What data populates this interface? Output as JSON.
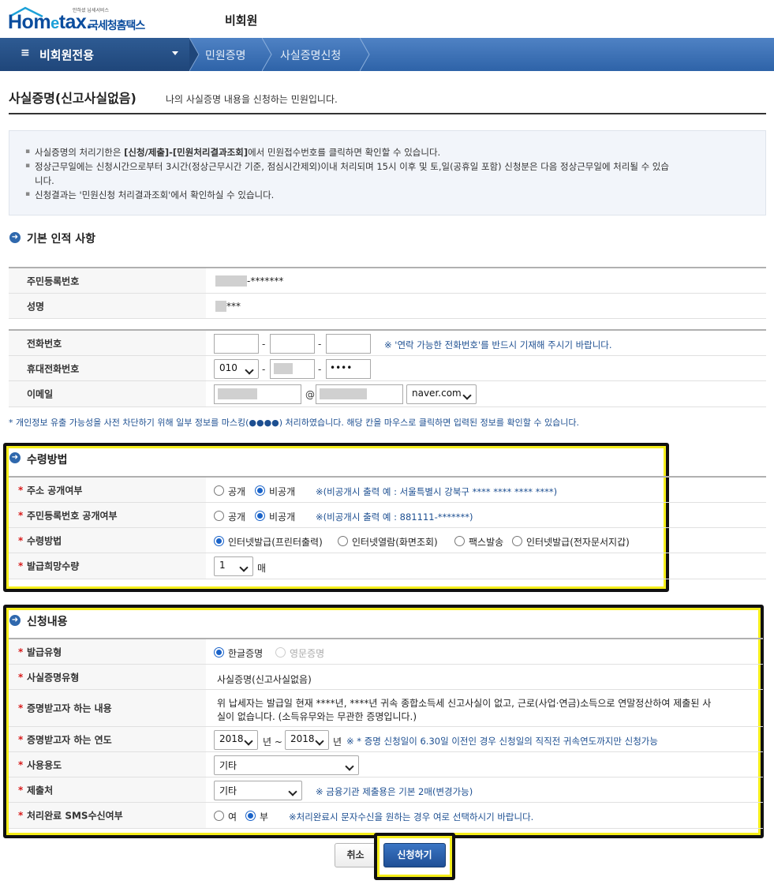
{
  "header": {
    "logo_tagline": "안하셨 납세서비스",
    "logo_home": "Hom",
    "logo_e": "e",
    "logo_tax": "tax.",
    "logo_kor": "국세청홈택스",
    "member_label": "비회원"
  },
  "nav": {
    "menu_label": "비회원전용",
    "items": [
      "민원증명",
      "사실증명신청"
    ]
  },
  "page": {
    "title": "사실증명(신고사실없음)",
    "subtitle": "나의 사실증명 내용을 신청하는 민원입니다."
  },
  "notice": {
    "line1_pre": "사실증명의 처리기한은 ",
    "line1_bold": "[신청/제출]-[민원처리결과조회]",
    "line1_post": "에서 민원접수번호를 클릭하면 확인할 수 있습니다.",
    "line2a": "정상근무일에는 신청시간으로부터 3시간(정상근무시간 기준, 점심시간제외)이내 처리되며 15시 이후 및 토,일(공휴일 포함) 신청분은 다음 정상근무일에 처리될 수 있습",
    "line2b": "니다.",
    "line3": "신청결과는 '민원신청 처리결과조회'에서 확인하실 수 있습니다."
  },
  "basic": {
    "section_title": "기본 인적 사항",
    "rrn_label": "주민등록번호",
    "rrn_value": "-*******",
    "name_label": "성명",
    "name_value": "***",
    "phone_label": "전화번호",
    "phone_note": "※ '연락 가능한 전화번호'를 반드시 기재해 주시기 바랍니다.",
    "mobile_label": "휴대전화번호",
    "mobile_prefix": "010",
    "mobile_last": "••••",
    "email_label": "이메일",
    "email_at": "@",
    "email_domain": "naver.com",
    "dash": "-"
  },
  "privacy_note": "* 개인정보 유출 가능성을 사전 차단하기 위해 일부 정보를 마스킹(●●●●) 처리하였습니다. 해당 칸을 마우스로 클릭하면 입력된 정보를 확인할 수 있습니다.",
  "receive": {
    "section_title": "수령방법",
    "req_mark": "*",
    "addr_label": "주소 공개여부",
    "addr_open": "공개",
    "addr_closed": "비공개",
    "addr_note": "※(비공개시 출력 예 : 서울특별시 강북구 **** **** **** ****)",
    "rrn_label": "주민등록번호 공개여부",
    "rrn_open": "공개",
    "rrn_closed": "비공개",
    "rrn_note": "※(비공개시 출력 예 : 881111-*******)",
    "method_label": "수령방법",
    "methods": [
      "인터넷발급(프린터출력)",
      "인터넷열람(화면조회)",
      "팩스발송",
      "인터넷발급(전자문서지갑)"
    ],
    "qty_label": "발급희망수량",
    "qty_value": "1",
    "qty_unit": "매"
  },
  "request": {
    "section_title": "신청내용",
    "type_label": "발급유형",
    "type_ko": "한글증명",
    "type_en": "영문증명",
    "cert_type_label": "사실증명유형",
    "cert_type_value": "사실증명(신고사실없음)",
    "content_label": "증명받고자 하는 내용",
    "content_line1": "위 납세자는 발급일 현재 ****년, ****년 귀속 종합소득세 신고사실이 없고, 근로(사업·연금)소득으로 연말정산하여 제출된 사",
    "content_line2": "실이 없습니다. (소득유무와는 무관한 증명입니다.)",
    "year_label": "증명받고자 하는 연도",
    "year_from": "2018",
    "year_unit1": "년 ~",
    "year_to": "2018",
    "year_unit2": "년",
    "year_note": "※ * 증명 신청일이 6.30일 이전인 경우 신청일의 직직전 귀속연도까지만 신청가능",
    "usage_label": "사용용도",
    "usage_value": "기타",
    "submit_to_label": "제출처",
    "submit_to_value": "기타",
    "submit_to_note": "※ 금융기관 제출용은 기본 2매(변경가능)",
    "sms_label": "처리완료 SMS수신여부",
    "sms_yes": "여",
    "sms_no": "부",
    "sms_note": "※처리완료시 문자수신을 원하는 경우 여로 선택하시기 바랍니다."
  },
  "buttons": {
    "cancel": "취소",
    "submit": "신청하기"
  }
}
